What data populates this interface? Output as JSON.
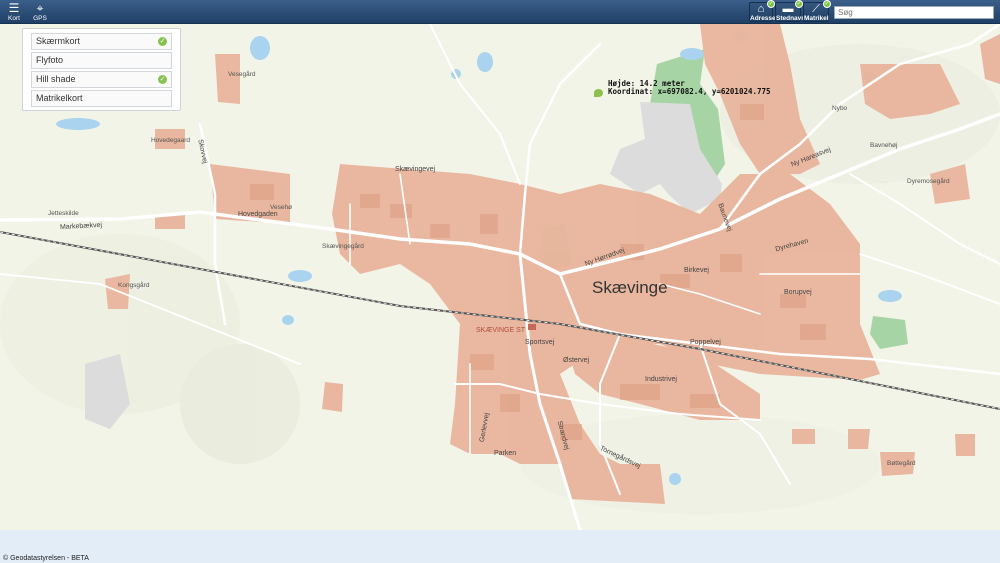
{
  "toolbar": {
    "kort_label": "Kort",
    "gps_label": "GPS",
    "adresse_label": "Adresse",
    "stednavn_label": "Stednavn",
    "matrikel_label": "Matrikel",
    "search_placeholder": "Søg"
  },
  "layers": [
    {
      "label": "Skærmkort",
      "active": true
    },
    {
      "label": "Flyfoto",
      "active": false
    },
    {
      "label": "Hill shade",
      "active": true
    },
    {
      "label": "Matrikelkort",
      "active": false
    }
  ],
  "info": {
    "height": "Højde: 14.2 meter",
    "coord": "Koordinat: x=697082.4, y=6201024.775"
  },
  "map": {
    "town_label": "Skævinge",
    "station_label": "SKÆVINGE ST",
    "streets": {
      "markebaekvej": "Markebækvej",
      "hovedgaden": "Hovedgaden",
      "skaevingevej": "Skævingevej",
      "ny_hoerroedvej": "Ny Hørrødvej",
      "ny_hareasvej": "Ny Hareasvej",
      "borupvej": "Borupvej",
      "poppelvej": "Poppelvej",
      "industrivej": "Industrivej",
      "oestervej": "Østervej",
      "sportsvej": "Sportsvej",
      "strandvej": "Strandvej",
      "gerlevvej": "Gerlevvej",
      "parken": "Parken",
      "tornegaardsvej": "Tornegårdsvej",
      "birkevej": "Birkevej",
      "dyrehaven": "Dyrehaven",
      "baunevej": "Baunevej",
      "tollerup": "Tollerupvej",
      "kongsgaard": "Kongsgård",
      "vesegaard": "Vesegård",
      "hovedgaard": "Hovedegaard",
      "bottegaard": "Bøttegård",
      "dyremosegaard": "Dyremosegård",
      "bavnehoj": "Bavnehøj",
      "nybo": "Nybo",
      "skaevingegaard": "Skævingegård",
      "veseho": "Vesehø",
      "skovvej": "Skovvej",
      "jetteshvej": "Jetteskilde"
    }
  },
  "footer": {
    "copyright": "© Geodatastyrelsen - BETA"
  },
  "colors": {
    "topbar": "#2c5080",
    "map_bg": "#f3f4e8",
    "urban": "#e9b49c",
    "water": "#a9d3ee",
    "forest": "#a7d4a5",
    "road": "#ffffff",
    "railway": "#4a4a4a"
  }
}
